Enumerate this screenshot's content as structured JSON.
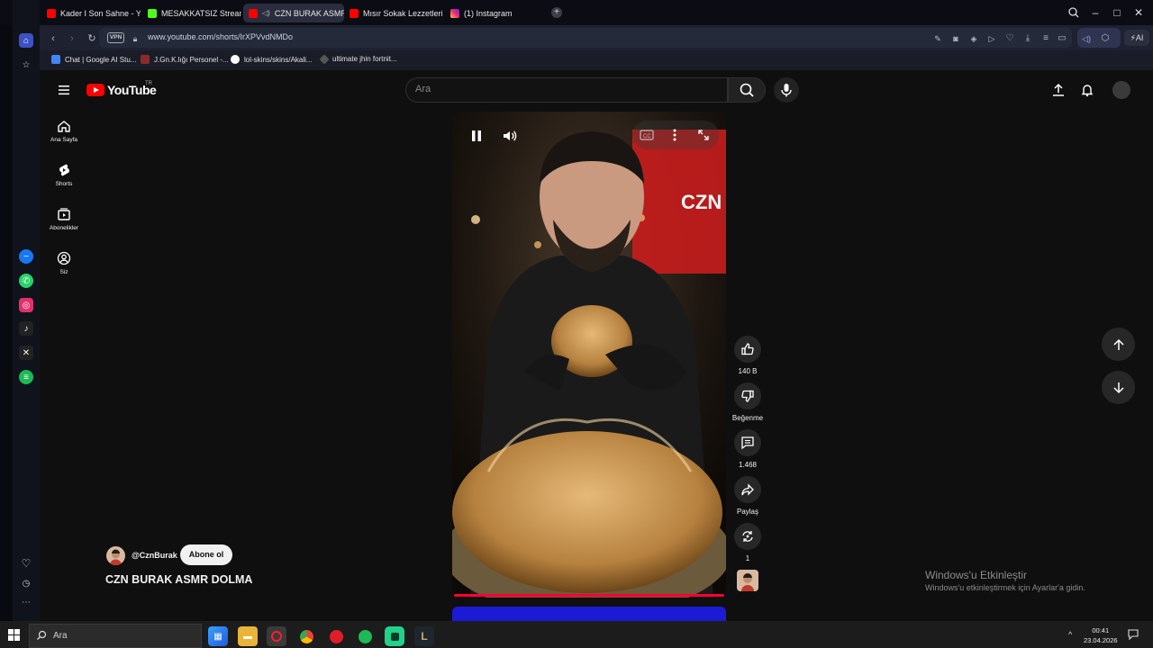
{
  "browser": {
    "tabs": [
      {
        "label": "Kader I Son Sahne - YouTu",
        "color": "#ff0000"
      },
      {
        "label": "MESAKKATSIZ Stream - W",
        "color": "#53fc18"
      },
      {
        "label": "CZN BURAK ASMR DO",
        "color": "#ff0000",
        "active": true
      },
      {
        "label": "Mısır Sokak Lezzetleri Kos",
        "color": "#ff0000"
      },
      {
        "label": "(1) Instagram",
        "color": "#e1306c"
      }
    ],
    "vpn_label": "VPN",
    "url": "www.youtube.com/shorts/IrXPVvdNMDo",
    "ai_label": "AI",
    "bookmarks": [
      {
        "label": "Chat | Google AI Stu...",
        "color": "#4285f4"
      },
      {
        "label": "J.Gn.K.lığı Personel -...",
        "color": "#8a2b2b"
      },
      {
        "label": "lol-skins/skins/Akali...",
        "color": "#ffffff"
      },
      {
        "label": "ultimate jhin fortnit...",
        "color": "#aaaaaa"
      }
    ]
  },
  "youtube": {
    "logo_text": "YouTube",
    "country": "TR",
    "search_placeholder": "Ara",
    "nav": [
      {
        "label": "Ana Sayfa",
        "icon": "home-icon"
      },
      {
        "label": "Shorts",
        "icon": "shorts-icon"
      },
      {
        "label": "Abonelikler",
        "icon": "subscriptions-icon"
      },
      {
        "label": "Siz",
        "icon": "user-icon"
      }
    ],
    "actions": {
      "like_count": "140 B",
      "dislike_label": "Beğenme",
      "comment_count": "1.468",
      "share_label": "Paylaş",
      "remix_count": "1"
    },
    "channel": {
      "handle": "@CznBurak",
      "subscribe_label": "Abone ol"
    },
    "video_title": "CZN BURAK ASMR DOLMA",
    "video_sign": "CZN Bur"
  },
  "windows": {
    "watermark_title": "Windows'u Etkinleştir",
    "watermark_sub": "Windows'u etkinleştirmek için Ayarlar'a gidin.",
    "search_placeholder": "Ara",
    "time": "00:41",
    "date": "23.04.2026"
  },
  "colors": {
    "accent": "#ff0000",
    "progress": "#ff0033"
  }
}
